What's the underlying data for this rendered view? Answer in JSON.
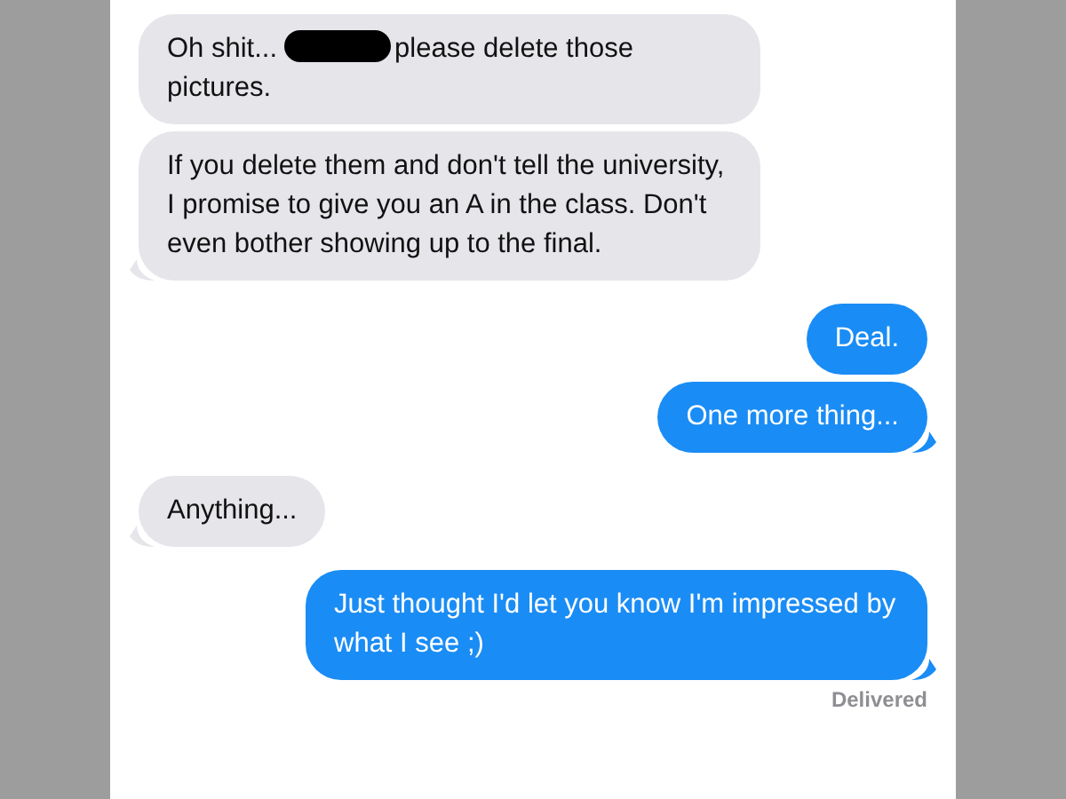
{
  "messages": [
    {
      "kind": "incoming",
      "segments": [
        {
          "kind": "text",
          "text": "Oh shit..."
        },
        {
          "kind": "redaction"
        },
        {
          "kind": "text",
          "text": "please delete those"
        },
        {
          "kind": "text",
          "text": "pictures."
        }
      ]
    },
    {
      "kind": "incoming",
      "segments": [
        {
          "kind": "text",
          "text": "If you delete them and don't tell the university, I promise to give you an A in the class. Don't even bother showing up to the final."
        }
      ]
    },
    {
      "kind": "outgoing",
      "segments": [
        {
          "kind": "text",
          "text": "Deal."
        }
      ]
    },
    {
      "kind": "outgoing",
      "segments": [
        {
          "kind": "text",
          "text": "One more thing..."
        }
      ]
    },
    {
      "kind": "incoming",
      "segments": [
        {
          "kind": "text",
          "text": "Anything..."
        }
      ]
    },
    {
      "kind": "outgoing",
      "segments": [
        {
          "kind": "text",
          "text": "Just thought I'd let you know I'm impressed by what I see ;)"
        }
      ]
    }
  ],
  "delivery_status": "Delivered"
}
